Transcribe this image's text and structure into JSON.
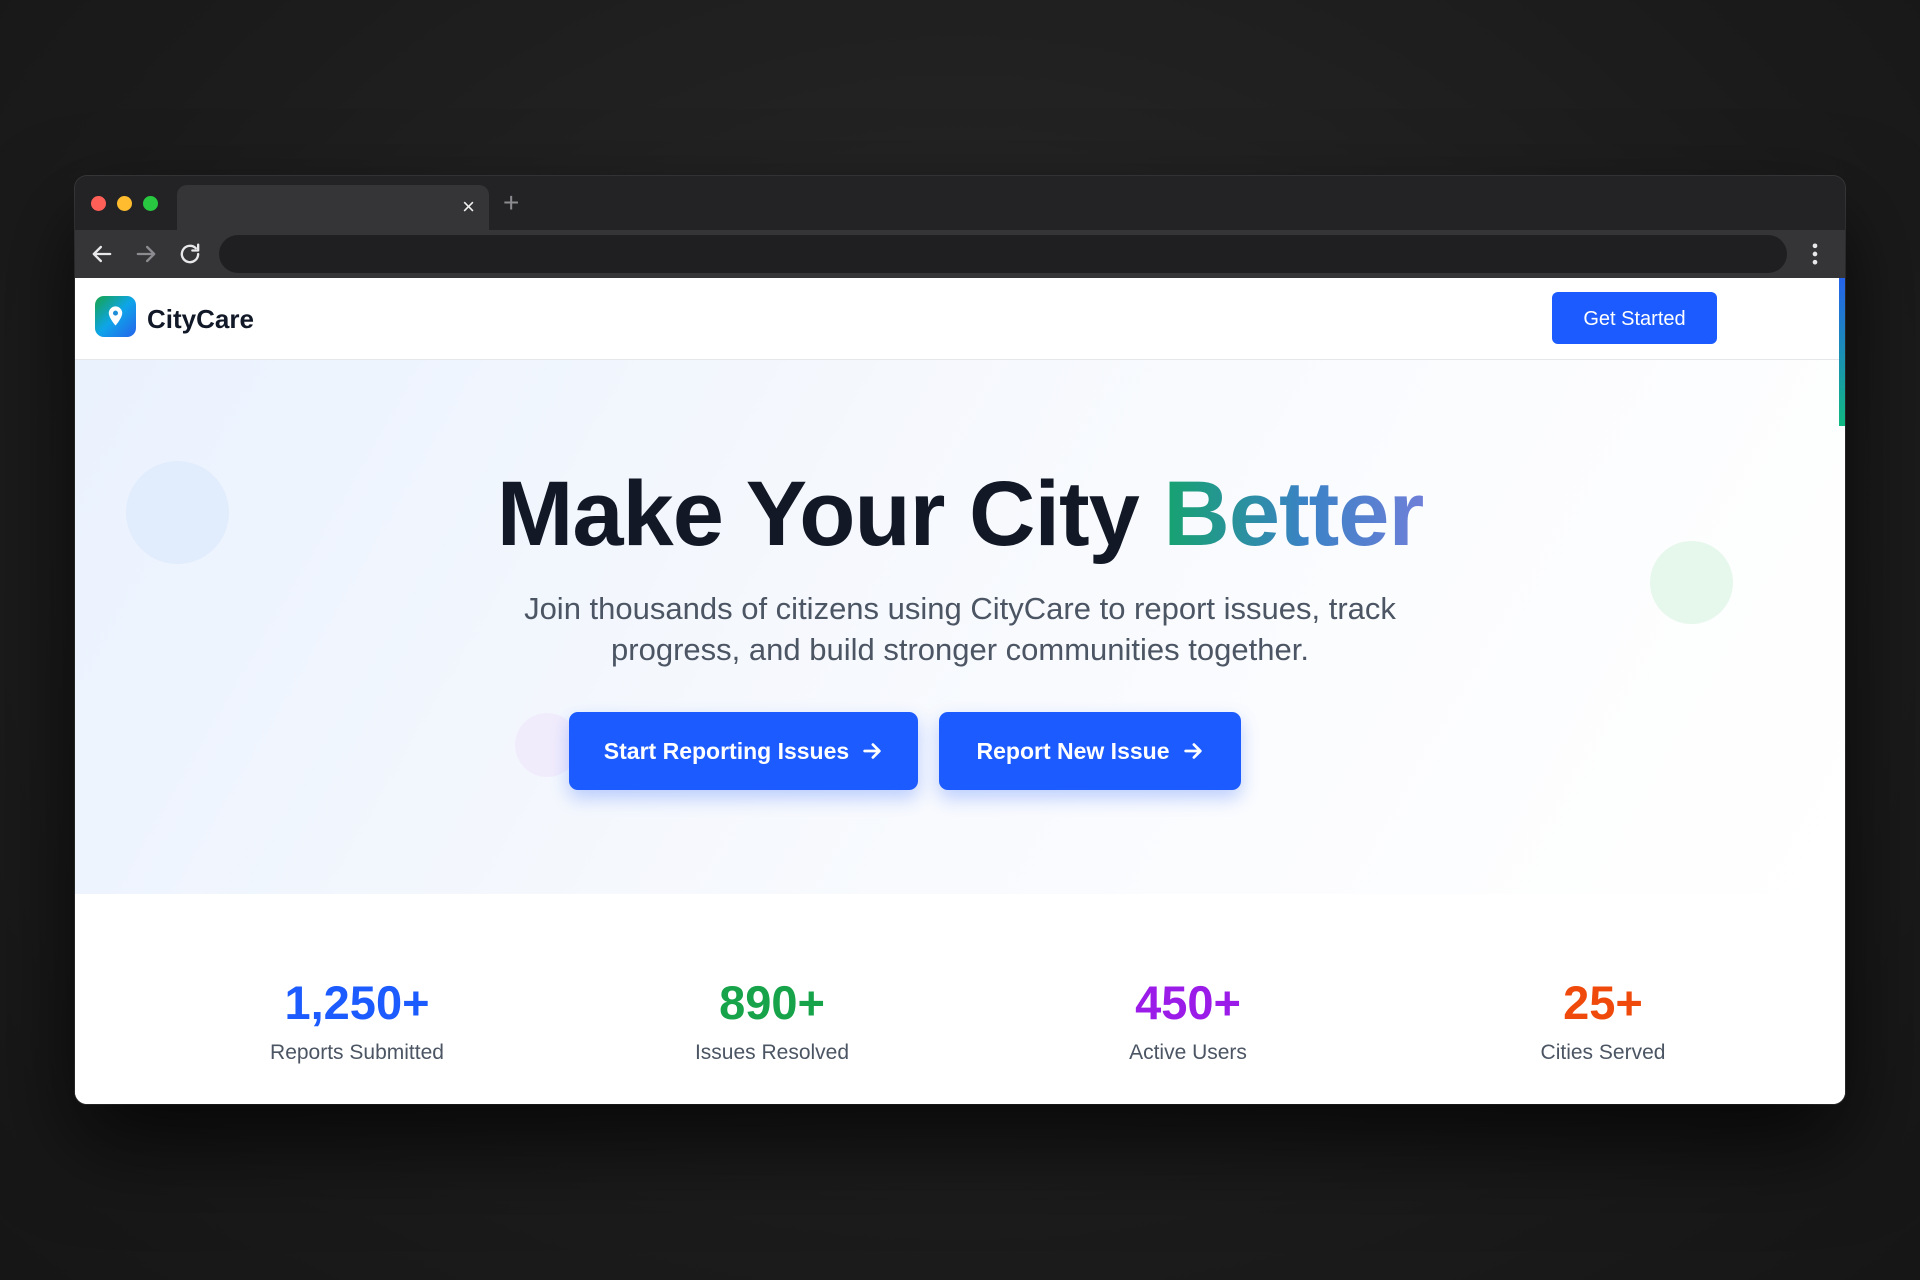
{
  "browser": {
    "tab": {
      "title": "",
      "close_glyph": "×"
    },
    "new_tab_glyph": "+",
    "address_bar": {
      "value": ""
    },
    "icons": [
      "back-arrow-icon",
      "forward-arrow-icon",
      "reload-icon",
      "kebab-menu-icon"
    ]
  },
  "navbar": {
    "brand": "CityCare",
    "logo_icon": "map-pin-icon",
    "cta_label": "Get Started"
  },
  "hero": {
    "headline_prefix": "Make Your City",
    "headline_accent": "Better",
    "subheadline": "Join thousands of citizens using CityCare to report issues, track progress, and build stronger communities together.",
    "primary_cta": "Start Reporting Issues",
    "secondary_cta": "Report New Issue",
    "cta_icon": "arrow-right-icon"
  },
  "stats": [
    {
      "value": "1,250+",
      "label": "Reports Submitted",
      "color": "#1b5bff"
    },
    {
      "value": "890+",
      "label": "Issues Resolved",
      "color": "#16a34a"
    },
    {
      "value": "450+",
      "label": "Active Users",
      "color": "#9b1be8"
    },
    {
      "value": "25+",
      "label": "Cities Served",
      "color": "#ef4a0b"
    }
  ],
  "colors": {
    "primary": "#1b5bff",
    "heading": "#121826",
    "body_text": "#4b5563",
    "accent_gradient": [
      "#16a36e",
      "#3b82c6",
      "#6f7fd8"
    ]
  }
}
